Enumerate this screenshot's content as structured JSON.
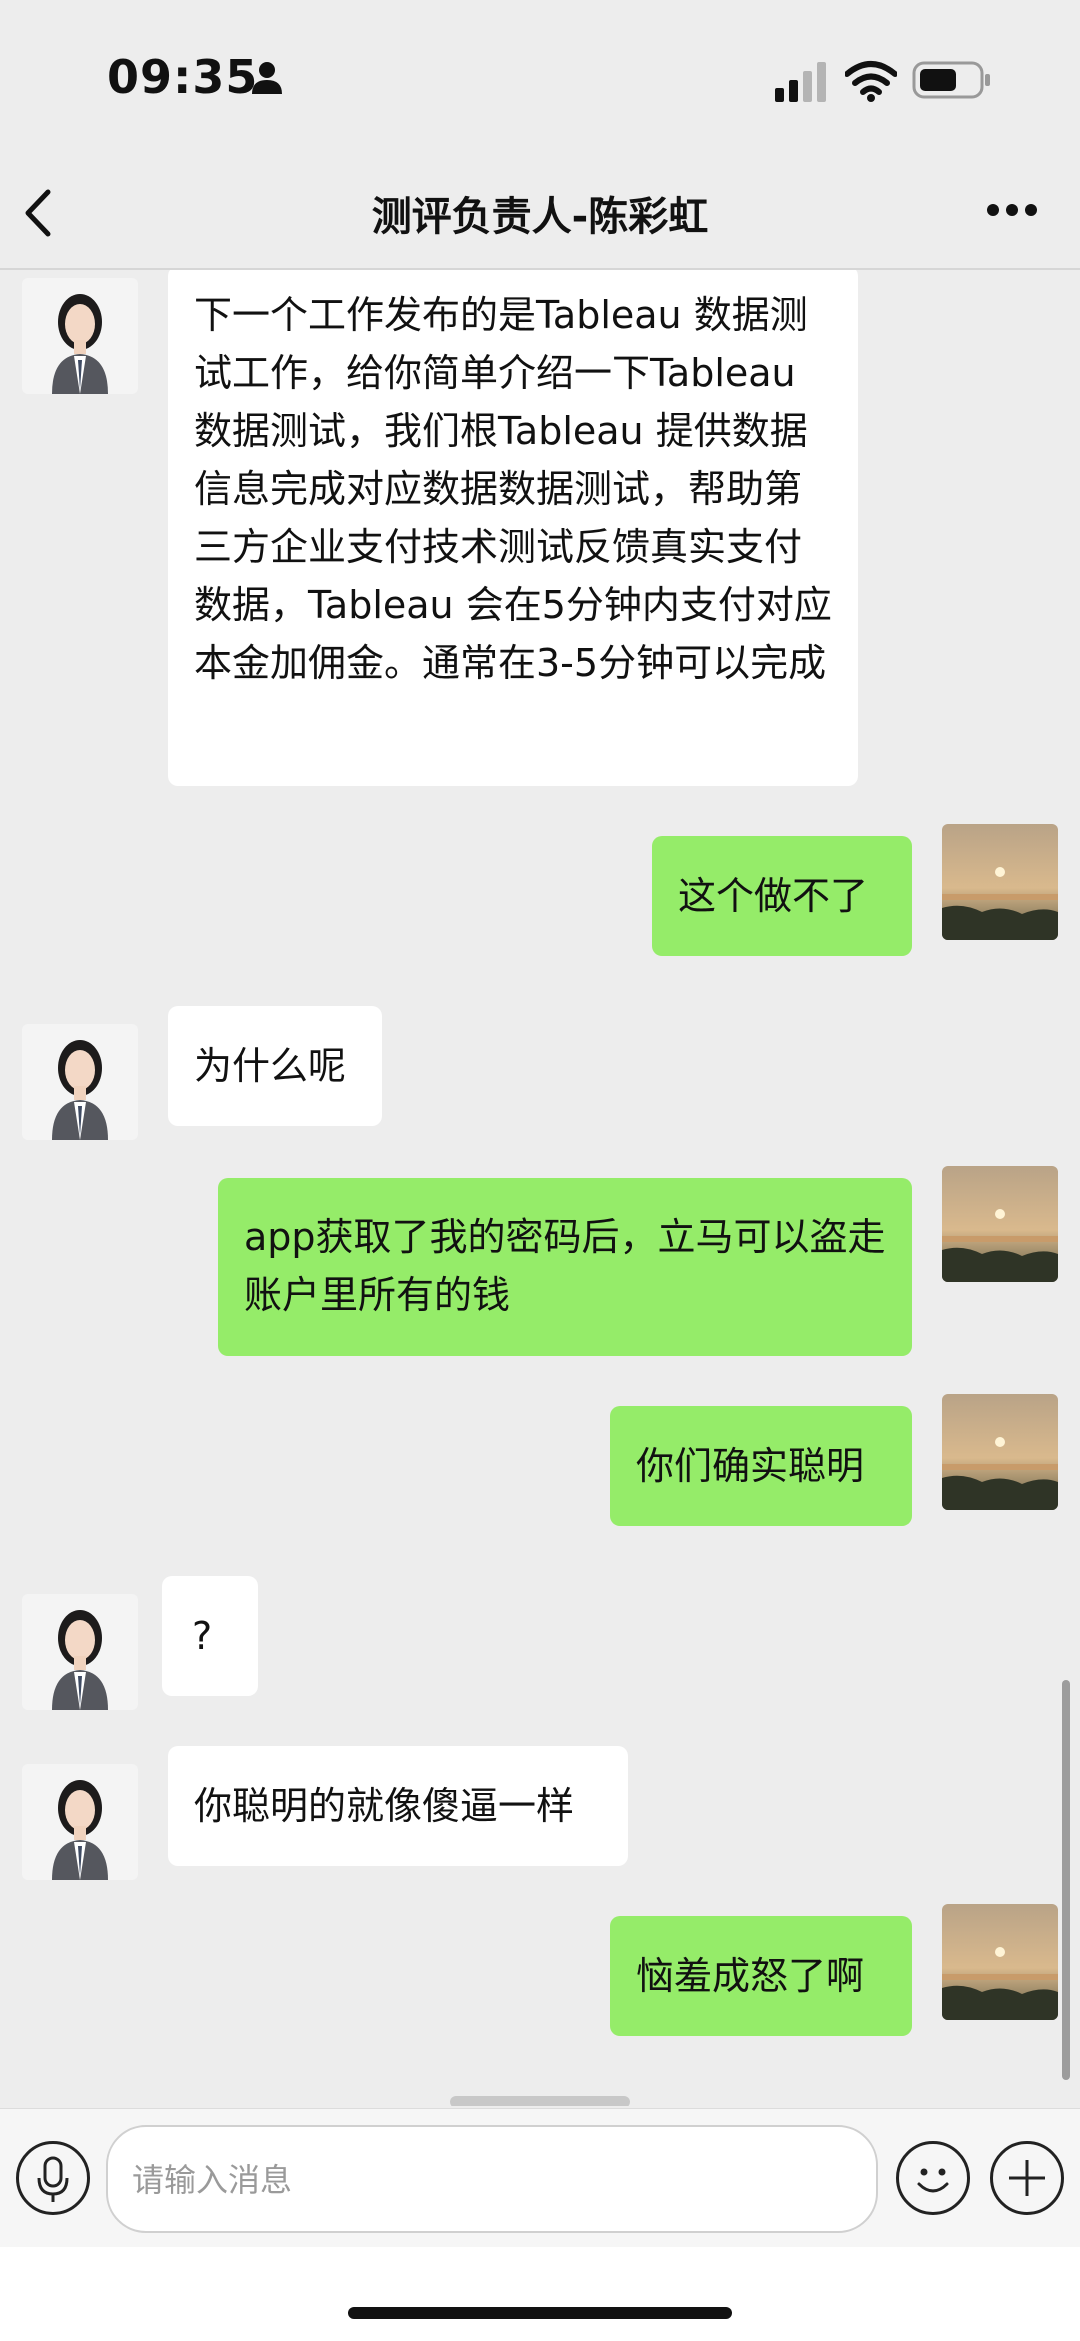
{
  "status_bar": {
    "time": "09:35"
  },
  "header": {
    "title": "测评负责人-陈彩虹"
  },
  "messages": [
    {
      "side": "in",
      "text": "下一个工作发布的是Tableau 数据测试工作，给你简单介绍一下Tableau 数据测试，我们根Tableau 提供数据信息完成对应数据数据测试，帮助第三方企业支付技术测试反馈真实支付数据，Tableau 会在5分钟内支付对应本金加佣金。通常在3-5分钟可以完成"
    },
    {
      "side": "out",
      "text": "这个做不了"
    },
    {
      "side": "in",
      "text": "为什么呢"
    },
    {
      "side": "out",
      "text": "app获取了我的密码后，立马可以盗走账户里所有的钱"
    },
    {
      "side": "out",
      "text": "你们确实聪明"
    },
    {
      "side": "in",
      "text": "?"
    },
    {
      "side": "in",
      "text": "你聪明的就像傻逼一样"
    },
    {
      "side": "out",
      "text": "恼羞成怒了啊"
    }
  ],
  "input_bar": {
    "placeholder": "请输入消息"
  },
  "icons": {
    "back": "back-arrow-icon",
    "more": "more-icon",
    "mic": "microphone-icon",
    "emoji": "emoji-icon",
    "plus": "plus-icon",
    "contact_avatar": "woman-portrait-avatar",
    "my_avatar": "sunset-landscape-avatar"
  },
  "colors": {
    "outgoing_bubble": "#95ec69",
    "incoming_bubble": "#ffffff",
    "background": "#ededed"
  }
}
